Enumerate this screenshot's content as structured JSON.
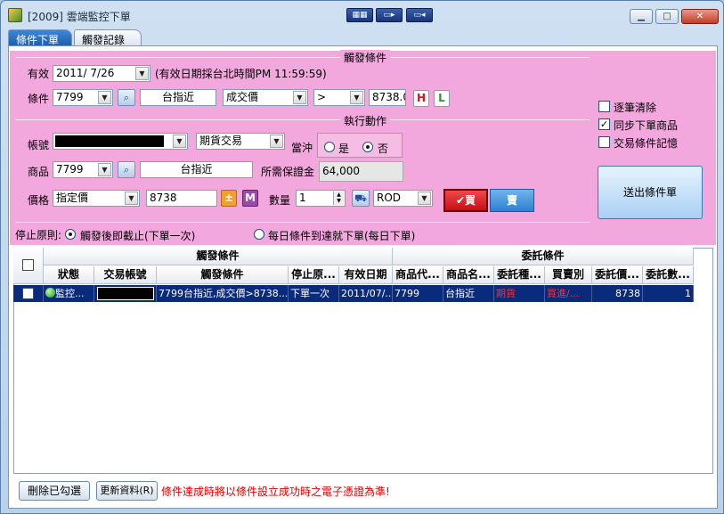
{
  "window": {
    "title": "[2009] 雲端監控下單",
    "controls": {
      "minimize": "▁",
      "maximize": "□",
      "close": "✕"
    },
    "toolbar_icons": [
      "layout-icon",
      "window-icon",
      "record-icon"
    ]
  },
  "tabs": [
    {
      "label": "條件下單",
      "active": true
    },
    {
      "label": "觸發記錄",
      "active": false
    }
  ],
  "trigger": {
    "group_title": "觸發條件",
    "valid_label": "有效",
    "valid_date": "2011/  7/26",
    "valid_note": "(有效日期採台北時間PM 11:59:59)",
    "cond_label": "條件",
    "cond_symbol": "7799",
    "cond_name": "台指近",
    "cond_field": "成交價",
    "cond_op": ">",
    "cond_value": "8738.00",
    "h_label": "H",
    "l_label": "L"
  },
  "action": {
    "group_title": "執行動作",
    "account_label": "帳號",
    "trade_type": "期貨交易",
    "daytrade_label": "當沖",
    "daytrade_yes": "是",
    "daytrade_no": "否",
    "product_label": "商品",
    "product_symbol": "7799",
    "product_name": "台指近",
    "margin_label": "所需保證金",
    "margin_value": "64,000",
    "price_label": "價格",
    "price_type": "指定價",
    "price_value": "8738",
    "pm_label": "±",
    "m_label": "M",
    "qty_label": "數量",
    "qty_value": "1",
    "tif": "ROD",
    "buy_label": "買",
    "sell_label": "賣"
  },
  "options": {
    "clear_each": "逐筆清除",
    "sync_product": "同步下單商品",
    "remember": "交易條件記憶",
    "submit": "送出條件單"
  },
  "stop_rule": {
    "label": "停止原則:",
    "opt1": "觸發後即截止(下單一次)",
    "opt2": "每日條件到達就下單(每日下單)"
  },
  "grid": {
    "group_trigger": "觸發條件",
    "group_order": "委託條件",
    "headers": [
      "狀態",
      "交易帳號",
      "觸發條件",
      "停止原...",
      "有效日期",
      "商品代...",
      "商品名...",
      "委託種...",
      "買賣別",
      "委託價...",
      "委託數..."
    ],
    "rows": [
      {
        "status": "監控...",
        "condition": "7799台指近,成交價>8738....",
        "stop": "下單一次",
        "date": "2011/07/...",
        "symbol": "7799",
        "name": "台指近",
        "order_type": "期貨",
        "side": "買進/...",
        "price": "8738",
        "qty": "1"
      }
    ]
  },
  "footer": {
    "delete_btn": "刪除已勾選",
    "refresh_btn": "更新資料(R)",
    "notice": "條件達成時將以條件設立成功時之電子憑證為準!",
    "notice_color": "#e00000"
  },
  "colors": {
    "panel": "#f2a8dc",
    "selected_row": "#0a2a7c",
    "buy": "#d9141e",
    "sell": "#2d7fd0"
  }
}
